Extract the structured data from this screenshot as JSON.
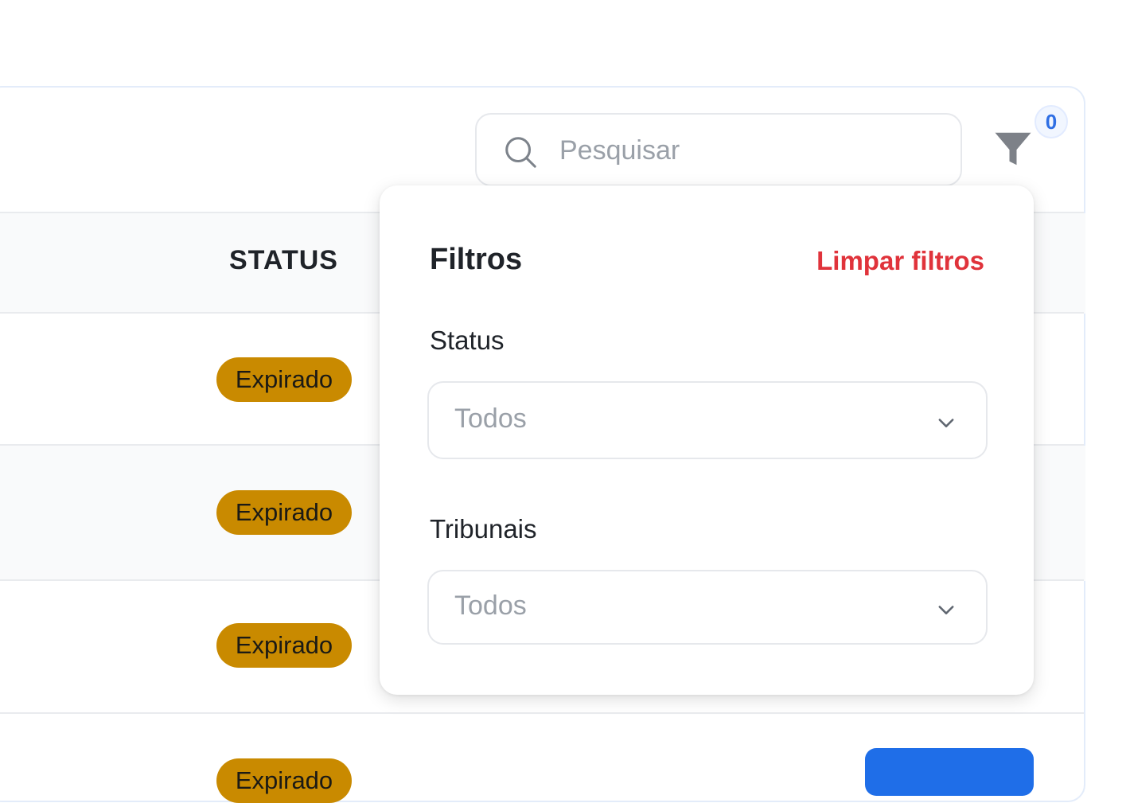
{
  "search": {
    "placeholder": "Pesquisar"
  },
  "filter": {
    "count": "0"
  },
  "table": {
    "status_header": "STATUS",
    "rows": [
      {
        "status": "Expirado"
      },
      {
        "status": "Expirado"
      },
      {
        "status": "Expirado"
      },
      {
        "status": "Expirado"
      }
    ]
  },
  "filters_panel": {
    "title": "Filtros",
    "clear_label": "Limpar filtros",
    "status": {
      "label": "Status",
      "value": "Todos"
    },
    "tribunais": {
      "label": "Tribunais",
      "value": "Todos"
    }
  },
  "colors": {
    "badge_expired": "#c98a00",
    "clear_link": "#e0333b",
    "filter_count": "#2f6fe4",
    "action_button": "#1f6ee8"
  }
}
